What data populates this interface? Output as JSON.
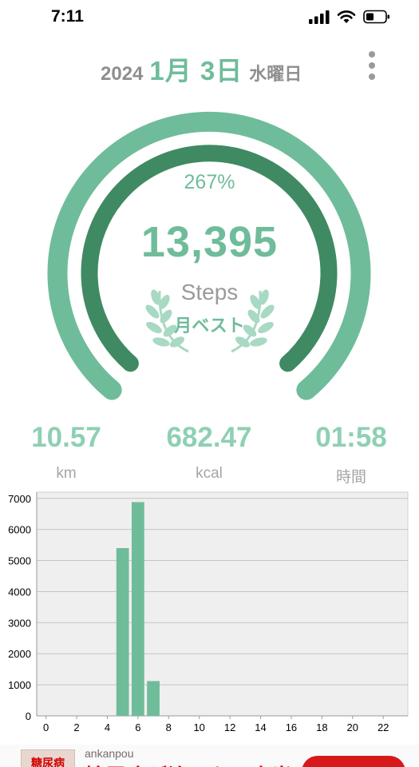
{
  "status_bar": {
    "time": "7:11"
  },
  "header": {
    "year": "2024",
    "month_day": "1月 3日",
    "weekday": "水曜日"
  },
  "summary": {
    "percent": "267%",
    "steps": "13,395",
    "steps_label": "Steps",
    "badge": "月ベスト",
    "goal_progress": 2.67
  },
  "stats": [
    {
      "value": "10.57",
      "unit": "km"
    },
    {
      "value": "682.47",
      "unit": "kcal"
    },
    {
      "value": "01:58",
      "unit": "時間"
    }
  ],
  "chart_data": {
    "type": "bar",
    "x": [
      0,
      1,
      2,
      3,
      4,
      5,
      6,
      7,
      8,
      9,
      10,
      11,
      12,
      13,
      14,
      15,
      16,
      17,
      18,
      19,
      20,
      21,
      22,
      23
    ],
    "values": [
      0,
      0,
      0,
      0,
      0,
      5400,
      6880,
      1120,
      0,
      0,
      0,
      0,
      0,
      0,
      0,
      0,
      0,
      0,
      0,
      0,
      0,
      0,
      0,
      0
    ],
    "x_ticks": [
      "0",
      "2",
      "4",
      "6",
      "8",
      "10",
      "12",
      "14",
      "16",
      "18",
      "20",
      "22"
    ],
    "y_ticks": [
      "0",
      "1000",
      "2000",
      "3000",
      "4000",
      "5000",
      "6000",
      "7000"
    ],
    "ylim": [
      0,
      7200
    ],
    "grid": true,
    "bar_color": "#6fbc9a",
    "background": "#efefef"
  },
  "ad": {
    "thumb_text": "糖尿病",
    "source": "ankanpou",
    "headline": "糖尿病が治らない本当"
  },
  "colors": {
    "accent": "#6fbc9a",
    "accent_dark": "#3f8a63",
    "gray_text": "#8e8e8e"
  }
}
